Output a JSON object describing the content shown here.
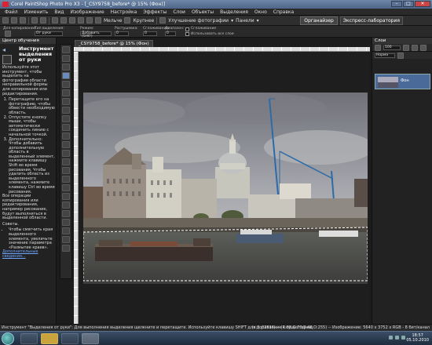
{
  "window": {
    "title": "Corel PaintShop Photo Pro X3 - [_CSY9758_before* @ 15% (Фон)]",
    "controls": [
      "–",
      "□",
      "✕"
    ]
  },
  "menu": [
    "Файл",
    "Изменить",
    "Вид",
    "Изображение",
    "Настройка",
    "Эффекты",
    "Слои",
    "Объекты",
    "Выделения",
    "Окно",
    "Справка"
  ],
  "toolbar": {
    "size_medium": "Мельче",
    "size_large": "Крупнее",
    "enhance": "Улучшение фотографии",
    "panels": "Панели",
    "tab_organizer": "Органайзер",
    "tab_express": "Экспресс-лаборатория"
  },
  "options": {
    "presets_label": "Для копирования",
    "selection_type_label": "Тип выделения:",
    "selection_type_value": "От руки",
    "mode_label": "Режим:",
    "mode_value": "Добавить (SHIF)",
    "feather_label": "Растушевка:",
    "feather_value": "0",
    "smoothing_label": "Сглаживание:",
    "smoothing_value": "0",
    "range_label": "Диапазон:",
    "range_value": "0",
    "antialias_label": "Сглаживание",
    "use_all_layers": "Использовать все слои"
  },
  "learning_center": {
    "header": "Центр обучения",
    "title": "Инструмент выделения от руки",
    "intro": "Используйте этот инструмент, чтобы выделить на фотографии области неправильной формы для копирования или редактирования.",
    "steps": [
      "Перетащите его на фотографию, чтобы обвести необходимую область.",
      "Отпустите кнопку мыши, чтобы автоматически соединить линию с начальной точкой.",
      "Дополнительно: Чтобы добавить дополнительную область в выделенный элемент, нажмите клавишу Shift во время рисования. Чтобы удалить область из выделенного элемента, нажмите клавишу Ctrl во время рисования."
    ],
    "note": "Все операции копирования или редактирования, например рисование, будут выполняться в выделенной области.",
    "tips_label": "Советы.",
    "tips": [
      "Чтобы смягчить края выделенного элемента, увеличьте значение параметра «Размытие краев»."
    ],
    "more_link": "Дополнительные сведения..."
  },
  "document": {
    "tab": "_CSY9758_before* @ 15% (Фон)"
  },
  "layers_panel": {
    "header": "Слои",
    "opacity": "100",
    "blend": "Норма",
    "layer_name": "Фон"
  },
  "statusbar": {
    "message": "Инструмент \"Выделения от руки\": Для выполнения выделения щелкните и перетащите. Используйте клавишу SHIFT для добавления к существующ",
    "info": "(x:3 y:2816) -- (R:68,G:70,B:48,O:255) -- Изображение: 5640 x 3752 x RGB - 8 бит/канал"
  },
  "taskbar": {
    "time": "18:57",
    "date": "05.10.2010"
  }
}
